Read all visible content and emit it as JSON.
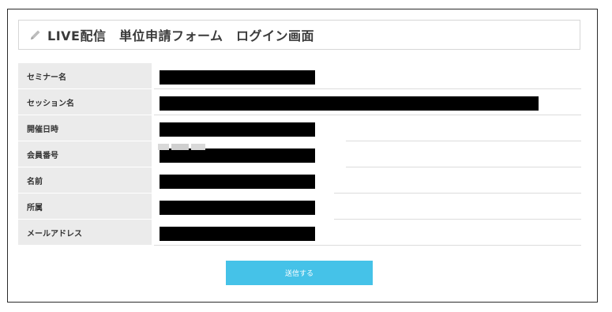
{
  "page": {
    "title": "LIVE配信　単位申請フォーム　ログイン画面"
  },
  "form": {
    "fields": [
      {
        "label": "セミナー名",
        "value_state": "redacted"
      },
      {
        "label": "セッション名",
        "value_state": "redacted"
      },
      {
        "label": "開催日時",
        "value_state": "redacted"
      },
      {
        "label": "会員番号",
        "value_state": "redacted"
      },
      {
        "label": "名前",
        "value_state": "redacted"
      },
      {
        "label": "所属",
        "value_state": "redacted"
      },
      {
        "label": "メールアドレス",
        "value_state": "redacted"
      }
    ],
    "submit_label": "送信する"
  },
  "icons": {
    "title_icon": "pencil-icon"
  },
  "colors": {
    "submit_button": "#45c2e8",
    "label_background": "#ebebeb",
    "redaction": "#000000",
    "frame_border": "#2b2b2b"
  }
}
